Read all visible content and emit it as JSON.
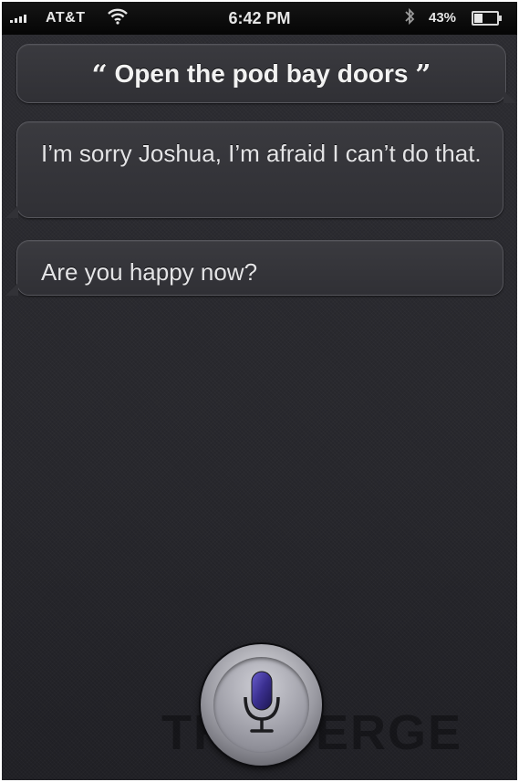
{
  "status_bar": {
    "carrier": "AT&T",
    "time": "6:42 PM",
    "battery_percent": "43%",
    "battery_level": 0.43,
    "signal_bars": 4,
    "icons": [
      "signal-bars-icon",
      "wifi-icon",
      "bluetooth-icon",
      "battery-icon"
    ]
  },
  "conversation": {
    "user_query": "Open the pod bay doors",
    "open_quote": "“",
    "close_quote": "”",
    "responses": [
      "I’m sorry Joshua, I’m afraid I can’t do that.",
      "Are you happy now?"
    ]
  },
  "watermark": "THE VERGE",
  "mic_button": {
    "icon": "microphone-icon",
    "accent": "#3a2f8f"
  },
  "colors": {
    "background": "#26262b",
    "bubble": "#343439",
    "text": "#f2f2f2"
  }
}
